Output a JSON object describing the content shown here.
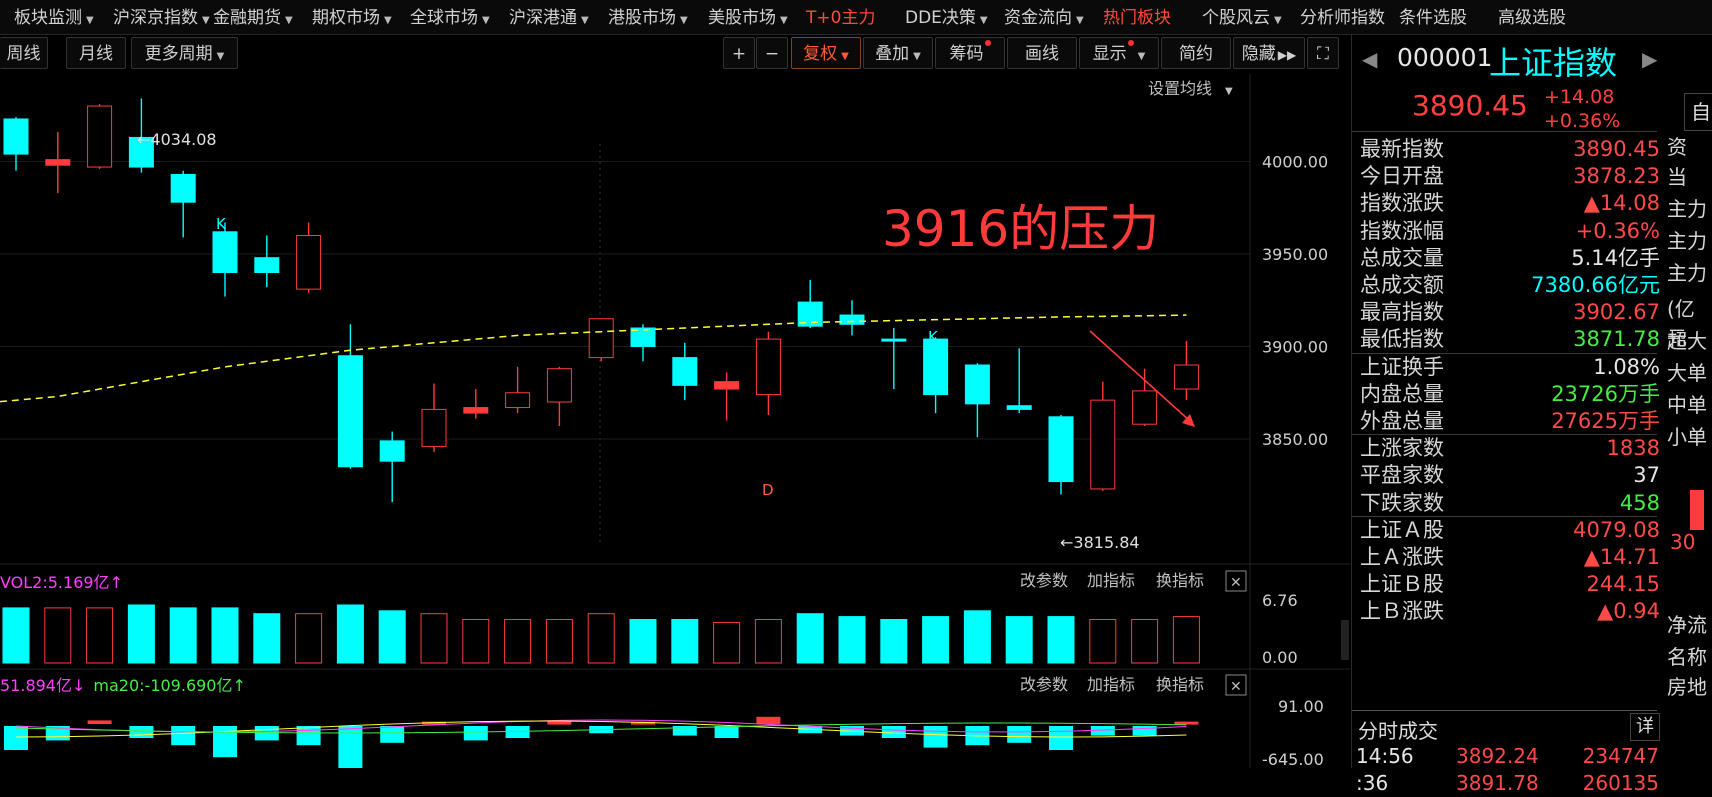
{
  "top_menu": [
    {
      "label": "板块监测",
      "hot": false,
      "caret": true
    },
    {
      "label": "沪深京指数",
      "hot": false,
      "caret": true
    },
    {
      "label": "金融期货",
      "hot": false,
      "caret": true
    },
    {
      "label": "期权市场",
      "hot": false,
      "caret": true
    },
    {
      "label": "全球市场",
      "hot": false,
      "caret": true
    },
    {
      "label": "沪深港通",
      "hot": false,
      "caret": true
    },
    {
      "label": "港股市场",
      "hot": false,
      "caret": true
    },
    {
      "label": "美股市场",
      "hot": false,
      "caret": true
    },
    {
      "label": "T+0主力",
      "hot": true,
      "caret": false
    },
    {
      "label": "DDE决策",
      "hot": false,
      "caret": true
    },
    {
      "label": "资金流向",
      "hot": false,
      "caret": true
    },
    {
      "label": "热门板块",
      "hot": true,
      "caret": false
    },
    {
      "label": "个股风云",
      "hot": false,
      "caret": true
    },
    {
      "label": "分析师指数",
      "hot": false,
      "caret": false
    },
    {
      "label": "条件选股",
      "hot": false,
      "caret": false
    },
    {
      "label": "高级选股",
      "hot": false,
      "caret": false
    }
  ],
  "toolbar": {
    "week": "周线",
    "month": "月线",
    "more_periods": "更多周期",
    "zoom_in": "+",
    "zoom_out": "−",
    "fuquan": "复权",
    "overlay": "叠加",
    "chips": "筹码",
    "draw": "画线",
    "display": "显示",
    "simple": "简约",
    "hide": "隐藏",
    "fullscreen": "⛶"
  },
  "main_chart": {
    "ma_setting": "设置均线",
    "annotation": "3916的压力",
    "high_label": "←4034.08",
    "low_label": "←3815.84",
    "marker_k1": "K",
    "marker_k2": "K",
    "marker_d": "D",
    "ma_level": 3916
  },
  "chart_data": {
    "type": "candlestick",
    "y_ticks": [
      "4000.00",
      "3950.00",
      "3900.00",
      "3850.00"
    ],
    "ylim": [
      3810,
      4045
    ],
    "candles": [
      {
        "o": 4023,
        "c": 4004,
        "h": 4024,
        "l": 3995
      },
      {
        "o": 3998,
        "c": 4001,
        "h": 4016,
        "l": 3983
      },
      {
        "o": 3997,
        "c": 4030,
        "h": 4031,
        "l": 3996
      },
      {
        "o": 4013,
        "c": 3997,
        "h": 4034.08,
        "l": 3994
      },
      {
        "o": 3993,
        "c": 3978,
        "h": 3995,
        "l": 3959
      },
      {
        "o": 3962,
        "c": 3940,
        "h": 3967,
        "l": 3927
      },
      {
        "o": 3948,
        "c": 3940,
        "h": 3960,
        "l": 3932
      },
      {
        "o": 3931,
        "c": 3960,
        "h": 3967,
        "l": 3929
      },
      {
        "o": 3895,
        "c": 3835,
        "h": 3912,
        "l": 3834
      },
      {
        "o": 3849,
        "c": 3838,
        "h": 3854,
        "l": 3815.84
      },
      {
        "o": 3846,
        "c": 3866,
        "h": 3880,
        "l": 3843
      },
      {
        "o": 3864,
        "c": 3867,
        "h": 3877,
        "l": 3861
      },
      {
        "o": 3867,
        "c": 3875,
        "h": 3889,
        "l": 3864
      },
      {
        "o": 3870,
        "c": 3888,
        "h": 3889,
        "l": 3857
      },
      {
        "o": 3894,
        "c": 3915,
        "h": 3915,
        "l": 3892
      },
      {
        "o": 3910,
        "c": 3900,
        "h": 3912,
        "l": 3892
      },
      {
        "o": 3894,
        "c": 3879,
        "h": 3902,
        "l": 3871
      },
      {
        "o": 3877,
        "c": 3881,
        "h": 3886,
        "l": 3860
      },
      {
        "o": 3874,
        "c": 3904,
        "h": 3908,
        "l": 3863
      },
      {
        "o": 3924,
        "c": 3911,
        "h": 3936,
        "l": 3910
      },
      {
        "o": 3917,
        "c": 3912,
        "h": 3925,
        "l": 3906
      },
      {
        "o": 3904,
        "c": 3903,
        "h": 3910,
        "l": 3877
      },
      {
        "o": 3904,
        "c": 3874,
        "h": 3905,
        "l": 3864
      },
      {
        "o": 3890,
        "c": 3869,
        "h": 3891,
        "l": 3851
      },
      {
        "o": 3868,
        "c": 3866,
        "h": 3899,
        "l": 3864
      },
      {
        "o": 3862,
        "c": 3827,
        "h": 3863,
        "l": 3820
      },
      {
        "o": 3823,
        "c": 3871,
        "h": 3881,
        "l": 3822
      },
      {
        "o": 3858,
        "c": 3876,
        "h": 3888,
        "l": 3857
      },
      {
        "o": 3877,
        "c": 3890,
        "h": 3903,
        "l": 3871
      }
    ],
    "ma_line": [
      3869,
      3873,
      3877,
      3881,
      3885,
      3889,
      3892,
      3895,
      3898,
      3900,
      3902,
      3904,
      3906,
      3907,
      3908,
      3909,
      3910,
      3911,
      3912,
      3913,
      3913.5,
      3914,
      3914.5,
      3915,
      3915.5,
      3916,
      3916.3,
      3916.6,
      3917
    ]
  },
  "vol_panel": {
    "label": "VOL2:5.169亿",
    "arrow": "↑",
    "tick_top": "6.76",
    "tick_bottom": "0.00",
    "btn_params": "改参数",
    "btn_add": "加指标",
    "btn_switch": "换指标",
    "btn_close": "✕"
  },
  "macd_panel": {
    "label1": "51.894亿",
    "arrow1": "↓",
    "label2": "ma20:-109.690亿",
    "arrow2": "↑",
    "tick_top": "91.00",
    "tick_bottom": "-645.00",
    "btn_params": "改参数",
    "btn_add": "加指标",
    "btn_switch": "换指标",
    "btn_close": "✕"
  },
  "sidebar": {
    "code": "000001",
    "name": "上证指数",
    "price": "3890.45",
    "change": "+14.08",
    "change_pct": "+0.36%",
    "right_btn": "自",
    "stats": [
      {
        "k": "最新指数",
        "v": "3890.45",
        "color": "#ff4a4a"
      },
      {
        "k": "今日开盘",
        "v": "3878.23",
        "color": "#ff4a4a"
      },
      {
        "k": "指数涨跌",
        "v": "▲14.08",
        "color": "#ff4a4a"
      },
      {
        "k": "指数涨幅",
        "v": "+0.36%",
        "color": "#ff4a4a"
      },
      {
        "k": "总成交量",
        "v": "5.14亿手",
        "color": "#e6e6e6"
      },
      {
        "k": "总成交额",
        "v": "7380.66亿元",
        "color": "#00ffff"
      },
      {
        "k": "最高指数",
        "v": "3902.67",
        "color": "#ff4a4a"
      },
      {
        "k": "最低指数",
        "v": "3871.78",
        "color": "#44ee44"
      },
      {
        "k": "上证换手",
        "v": "1.08%",
        "color": "#e6e6e6"
      },
      {
        "k": "内盘总量",
        "v": "23726万手",
        "color": "#44ee44"
      },
      {
        "k": "外盘总量",
        "v": "27625万手",
        "color": "#ff4a4a"
      },
      {
        "k": "上涨家数",
        "v": "1838",
        "color": "#ff4a4a"
      },
      {
        "k": "平盘家数",
        "v": "37",
        "color": "#e6e6e6"
      },
      {
        "k": "下跌家数",
        "v": "458",
        "color": "#44ee44"
      },
      {
        "k": "上证Ａ股",
        "v": "4079.08",
        "color": "#ff4a4a"
      },
      {
        "k": "上Ａ涨跌",
        "v": "▲14.71",
        "color": "#ff4a4a"
      },
      {
        "k": "上证Ｂ股",
        "v": "244.15",
        "color": "#ff4a4a"
      },
      {
        "k": "上Ｂ涨跌",
        "v": "▲0.94",
        "color": "#ff4a4a"
      }
    ],
    "right_col": [
      "资",
      "当",
      "主力",
      "主力",
      "主力",
      "(亿元",
      "超大",
      "大单",
      "中单",
      "小单",
      "30",
      "净流",
      "名称",
      "房地"
    ],
    "trades_title": "分时成交",
    "trades_btn": "详",
    "trades": [
      {
        "time": "14:56",
        "price": "3892.24",
        "vol": "234747"
      },
      {
        "time": ":36",
        "price": "3891.78",
        "vol": "260135"
      }
    ]
  },
  "colors": {
    "up": "#ff3b3b",
    "down": "#00ffff",
    "ma": "#ffff33",
    "annotation": "#ff3a3a"
  }
}
